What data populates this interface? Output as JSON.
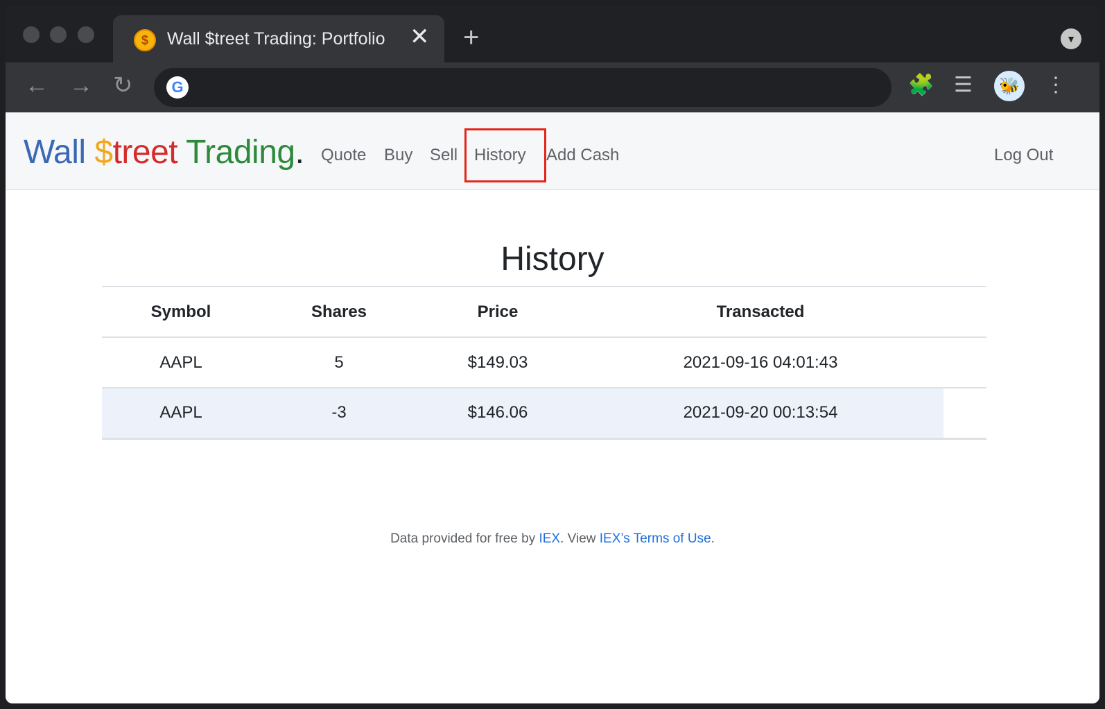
{
  "browser": {
    "tab_title": "Wall $treet Trading: Portfolio",
    "tab_favicon": "$",
    "close_glyph": "✕",
    "new_tab_glyph": "+",
    "back_glyph": "←",
    "forward_glyph": "→",
    "reload_glyph": "↻",
    "tab_menu_glyph": "▼",
    "omnibox_google_glyph": "G",
    "extensions_glyph": "🧩",
    "media_glyph": "☰",
    "profile_glyph": "🐝",
    "menu_glyph": "⋮"
  },
  "navbar": {
    "brand": {
      "part1": "Wall ",
      "part2": "$",
      "part3": "treet ",
      "part4": "Trading",
      "part5": "."
    },
    "links": {
      "quote": "Quote",
      "buy": "Buy",
      "sell": "Sell",
      "history": "History",
      "add_cash": "Add Cash"
    },
    "logout": "Log Out"
  },
  "main": {
    "title": "History",
    "table": {
      "headers": {
        "symbol": "Symbol",
        "shares": "Shares",
        "price": "Price",
        "transacted": "Transacted"
      },
      "rows": [
        {
          "symbol": "AAPL",
          "shares": "5",
          "price": "$149.03",
          "transacted": "2021-09-16 04:01:43"
        },
        {
          "symbol": "AAPL",
          "shares": "-3",
          "price": "$146.06",
          "transacted": "2021-09-20 00:13:54"
        }
      ]
    }
  },
  "footer": {
    "prefix": "Data provided for free by ",
    "iex_link": "IEX",
    "middle": ". View ",
    "terms_link": "IEX’s Terms of Use",
    "suffix": "."
  }
}
